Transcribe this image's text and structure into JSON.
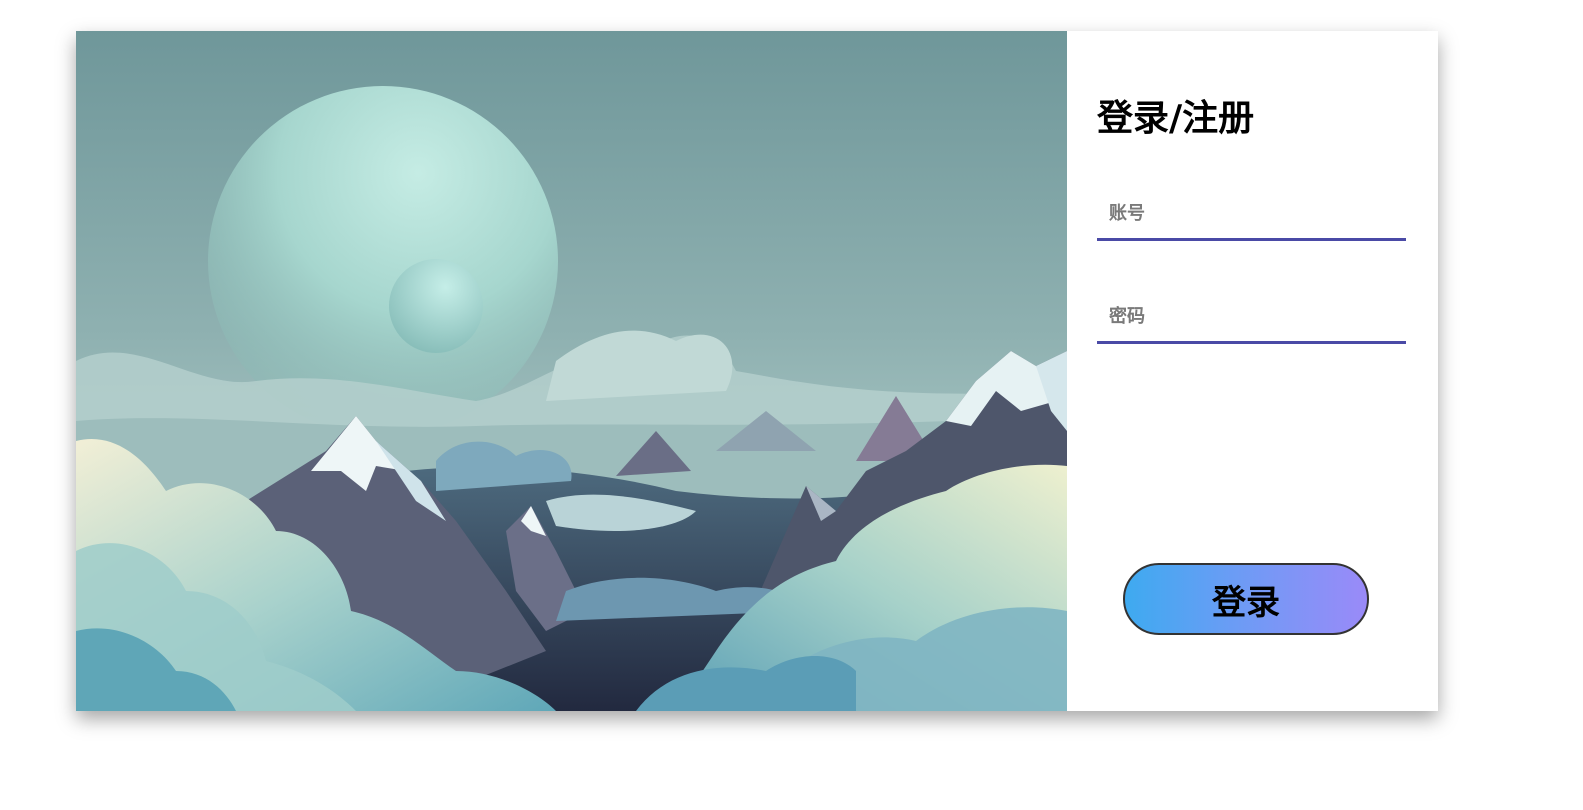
{
  "login_card": {
    "title": "登录/注册",
    "account_placeholder": "账号",
    "password_placeholder": "密码",
    "submit_label": "登录"
  },
  "colors": {
    "accent_underline": "#4a4aa6",
    "button_gradient_start": "#3eaaf0",
    "button_gradient_end": "#9a8af8"
  }
}
